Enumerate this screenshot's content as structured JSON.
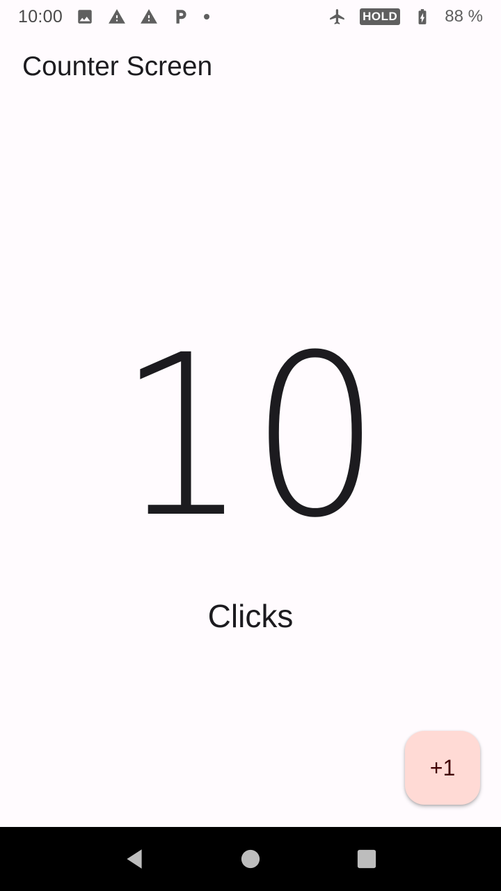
{
  "status_bar": {
    "time": "10:00",
    "hold_label": "HOLD",
    "battery_percent": "88 %",
    "icons_left": [
      "image-icon",
      "warning-icon",
      "warning-icon",
      "parking-icon",
      "dot-icon"
    ],
    "icons_right": [
      "airplane-mode-icon",
      "hold-badge",
      "battery-charging-icon"
    ]
  },
  "header": {
    "title": "Counter Screen"
  },
  "counter": {
    "value": "10",
    "label": "Clicks"
  },
  "fab": {
    "label": "+1",
    "background": "#ffdad5",
    "text_color": "#410002"
  },
  "navigation": {
    "buttons": [
      "back-icon",
      "home-icon",
      "recents-icon"
    ]
  },
  "colors": {
    "background": "#fffbfe",
    "text": "#1c1b1f",
    "nav_bar": "#000000"
  }
}
